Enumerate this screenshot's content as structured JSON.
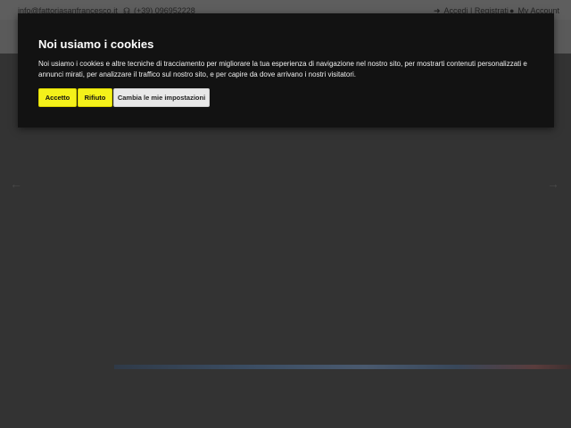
{
  "topbar": {
    "email": "info@fattoriasanfrancesco.it",
    "phone": "(+39) 096952228",
    "login_label": "Accedi | Registrati",
    "account_label": "My Account"
  },
  "carousel": {
    "prev_icon": "chevron-left-icon",
    "next_icon": "chevron-right-icon"
  },
  "cookie_banner": {
    "title": "Noi usiamo i cookies",
    "text": "Noi usiamo i cookies e altre tecniche di tracciamento per migliorare la tua esperienza di navigazione nel nostro sito, per mostrarti contenuti personalizzati e annunci mirati, per analizzare il traffico sul nostro sito, e per capire da dove arrivano i nostri visitatori.",
    "accept_label": "Accetto",
    "reject_label": "Rifiuto",
    "settings_label": "Cambia le mie impostazioni",
    "accent_color": "#f4f11a"
  }
}
